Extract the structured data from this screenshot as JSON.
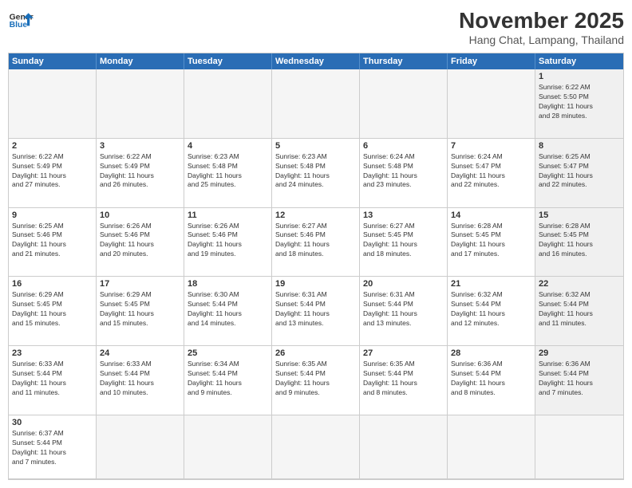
{
  "header": {
    "logo_line1": "General",
    "logo_line2": "Blue",
    "month": "November 2025",
    "location": "Hang Chat, Lampang, Thailand"
  },
  "days": [
    "Sunday",
    "Monday",
    "Tuesday",
    "Wednesday",
    "Thursday",
    "Friday",
    "Saturday"
  ],
  "cells": [
    {
      "num": "",
      "info": "",
      "empty": true
    },
    {
      "num": "",
      "info": "",
      "empty": true
    },
    {
      "num": "",
      "info": "",
      "empty": true
    },
    {
      "num": "",
      "info": "",
      "empty": true
    },
    {
      "num": "",
      "info": "",
      "empty": true
    },
    {
      "num": "",
      "info": "",
      "empty": true
    },
    {
      "num": "1",
      "info": "Sunrise: 6:22 AM\nSunset: 5:50 PM\nDaylight: 11 hours\nand 28 minutes.",
      "empty": false,
      "shaded": true
    },
    {
      "num": "2",
      "info": "Sunrise: 6:22 AM\nSunset: 5:49 PM\nDaylight: 11 hours\nand 27 minutes.",
      "empty": false
    },
    {
      "num": "3",
      "info": "Sunrise: 6:22 AM\nSunset: 5:49 PM\nDaylight: 11 hours\nand 26 minutes.",
      "empty": false
    },
    {
      "num": "4",
      "info": "Sunrise: 6:23 AM\nSunset: 5:48 PM\nDaylight: 11 hours\nand 25 minutes.",
      "empty": false
    },
    {
      "num": "5",
      "info": "Sunrise: 6:23 AM\nSunset: 5:48 PM\nDaylight: 11 hours\nand 24 minutes.",
      "empty": false
    },
    {
      "num": "6",
      "info": "Sunrise: 6:24 AM\nSunset: 5:48 PM\nDaylight: 11 hours\nand 23 minutes.",
      "empty": false
    },
    {
      "num": "7",
      "info": "Sunrise: 6:24 AM\nSunset: 5:47 PM\nDaylight: 11 hours\nand 22 minutes.",
      "empty": false
    },
    {
      "num": "8",
      "info": "Sunrise: 6:25 AM\nSunset: 5:47 PM\nDaylight: 11 hours\nand 22 minutes.",
      "empty": false,
      "shaded": true
    },
    {
      "num": "9",
      "info": "Sunrise: 6:25 AM\nSunset: 5:46 PM\nDaylight: 11 hours\nand 21 minutes.",
      "empty": false
    },
    {
      "num": "10",
      "info": "Sunrise: 6:26 AM\nSunset: 5:46 PM\nDaylight: 11 hours\nand 20 minutes.",
      "empty": false
    },
    {
      "num": "11",
      "info": "Sunrise: 6:26 AM\nSunset: 5:46 PM\nDaylight: 11 hours\nand 19 minutes.",
      "empty": false
    },
    {
      "num": "12",
      "info": "Sunrise: 6:27 AM\nSunset: 5:46 PM\nDaylight: 11 hours\nand 18 minutes.",
      "empty": false
    },
    {
      "num": "13",
      "info": "Sunrise: 6:27 AM\nSunset: 5:45 PM\nDaylight: 11 hours\nand 18 minutes.",
      "empty": false
    },
    {
      "num": "14",
      "info": "Sunrise: 6:28 AM\nSunset: 5:45 PM\nDaylight: 11 hours\nand 17 minutes.",
      "empty": false
    },
    {
      "num": "15",
      "info": "Sunrise: 6:28 AM\nSunset: 5:45 PM\nDaylight: 11 hours\nand 16 minutes.",
      "empty": false,
      "shaded": true
    },
    {
      "num": "16",
      "info": "Sunrise: 6:29 AM\nSunset: 5:45 PM\nDaylight: 11 hours\nand 15 minutes.",
      "empty": false
    },
    {
      "num": "17",
      "info": "Sunrise: 6:29 AM\nSunset: 5:45 PM\nDaylight: 11 hours\nand 15 minutes.",
      "empty": false
    },
    {
      "num": "18",
      "info": "Sunrise: 6:30 AM\nSunset: 5:44 PM\nDaylight: 11 hours\nand 14 minutes.",
      "empty": false
    },
    {
      "num": "19",
      "info": "Sunrise: 6:31 AM\nSunset: 5:44 PM\nDaylight: 11 hours\nand 13 minutes.",
      "empty": false
    },
    {
      "num": "20",
      "info": "Sunrise: 6:31 AM\nSunset: 5:44 PM\nDaylight: 11 hours\nand 13 minutes.",
      "empty": false
    },
    {
      "num": "21",
      "info": "Sunrise: 6:32 AM\nSunset: 5:44 PM\nDaylight: 11 hours\nand 12 minutes.",
      "empty": false
    },
    {
      "num": "22",
      "info": "Sunrise: 6:32 AM\nSunset: 5:44 PM\nDaylight: 11 hours\nand 11 minutes.",
      "empty": false,
      "shaded": true
    },
    {
      "num": "23",
      "info": "Sunrise: 6:33 AM\nSunset: 5:44 PM\nDaylight: 11 hours\nand 11 minutes.",
      "empty": false
    },
    {
      "num": "24",
      "info": "Sunrise: 6:33 AM\nSunset: 5:44 PM\nDaylight: 11 hours\nand 10 minutes.",
      "empty": false
    },
    {
      "num": "25",
      "info": "Sunrise: 6:34 AM\nSunset: 5:44 PM\nDaylight: 11 hours\nand 9 minutes.",
      "empty": false
    },
    {
      "num": "26",
      "info": "Sunrise: 6:35 AM\nSunset: 5:44 PM\nDaylight: 11 hours\nand 9 minutes.",
      "empty": false
    },
    {
      "num": "27",
      "info": "Sunrise: 6:35 AM\nSunset: 5:44 PM\nDaylight: 11 hours\nand 8 minutes.",
      "empty": false
    },
    {
      "num": "28",
      "info": "Sunrise: 6:36 AM\nSunset: 5:44 PM\nDaylight: 11 hours\nand 8 minutes.",
      "empty": false
    },
    {
      "num": "29",
      "info": "Sunrise: 6:36 AM\nSunset: 5:44 PM\nDaylight: 11 hours\nand 7 minutes.",
      "empty": false,
      "shaded": true
    },
    {
      "num": "30",
      "info": "Sunrise: 6:37 AM\nSunset: 5:44 PM\nDaylight: 11 hours\nand 7 minutes.",
      "empty": false
    },
    {
      "num": "",
      "info": "",
      "empty": true
    },
    {
      "num": "",
      "info": "",
      "empty": true
    },
    {
      "num": "",
      "info": "",
      "empty": true
    },
    {
      "num": "",
      "info": "",
      "empty": true
    },
    {
      "num": "",
      "info": "",
      "empty": true
    },
    {
      "num": "",
      "info": "",
      "empty": true,
      "shaded": true
    }
  ]
}
